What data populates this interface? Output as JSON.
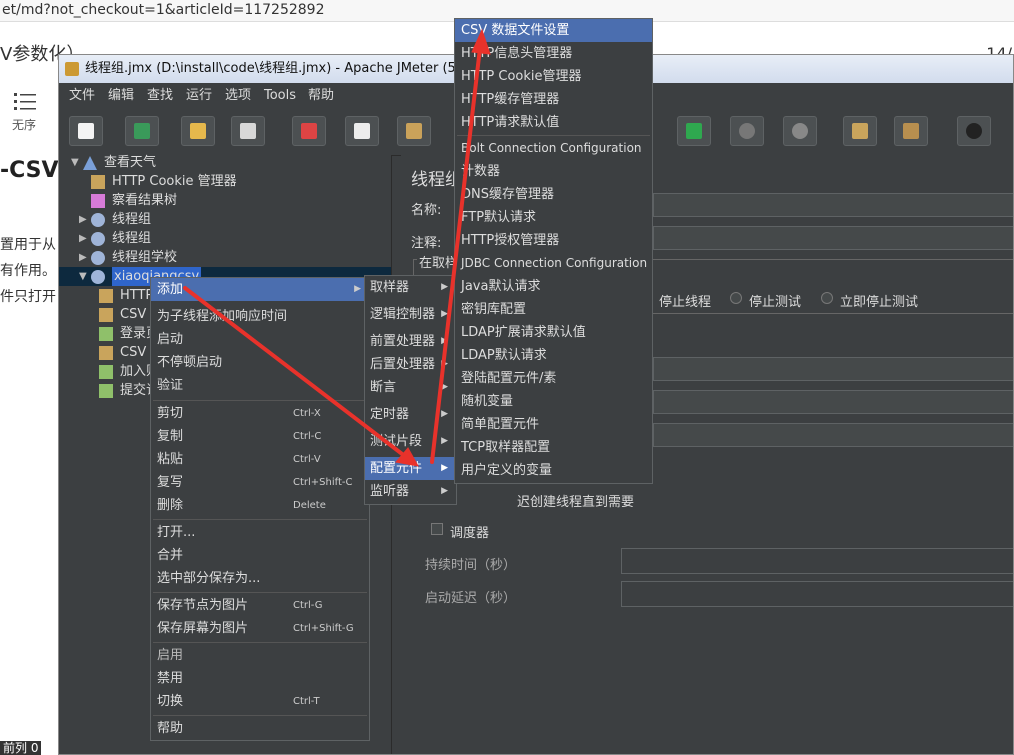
{
  "browser": {
    "url": "et/md?not_checkout=1&articleId=117252892",
    "tab_title": "V参数化）",
    "page_num": "14/",
    "list_label": "无序",
    "heading": "-CSV",
    "lines": [
      "置用于从",
      "有作用。",
      "件只打开"
    ],
    "status": "前列 0"
  },
  "window": {
    "title": "线程组.jmx (D:\\install\\code\\线程组.jmx) - Apache JMeter (5.2)",
    "menu": [
      "文件",
      "编辑",
      "查找",
      "运行",
      "选项",
      "Tools",
      "帮助"
    ]
  },
  "toolbar": {
    "icons": [
      "new-icon",
      "templates-icon",
      "open-icon",
      "save-icon",
      "cut-icon",
      "copy-icon",
      "paste-icon",
      "start-no-pause-icon",
      "stop-icon",
      "shutdown-icon",
      "clear-icon",
      "clear-all-icon",
      "search-icon"
    ]
  },
  "tree": {
    "items": [
      {
        "label": "查看天气"
      },
      {
        "label": "HTTP Cookie 管理器"
      },
      {
        "label": "察看结果树"
      },
      {
        "label": "线程组"
      },
      {
        "label": "线程组"
      },
      {
        "label": "线程组学校"
      },
      {
        "label": "xiaoqiangcsv"
      },
      {
        "label": "HTTP"
      },
      {
        "label": "CSV"
      },
      {
        "label": "登录页"
      },
      {
        "label": "CSV"
      },
      {
        "label": "加入则"
      },
      {
        "label": "提交订"
      }
    ]
  },
  "panel": {
    "title": "线程组",
    "name_label": "名称:",
    "comment_label": "注释:",
    "group_title": "在取样",
    "radio_stop_thread": "停止线程",
    "radio_stop_test": "停止测试",
    "radio_stop_now": "立即停止测试",
    "delay_create": "迟创建线程直到需要",
    "scheduler": "调度器",
    "duration_label": "持续时间（秒）",
    "startup_delay_label": "启动延迟（秒）"
  },
  "context_menu": {
    "items": [
      {
        "label": "添加",
        "shortcut": ""
      },
      {
        "label": "为子线程添加响应时间",
        "shortcut": ""
      },
      {
        "label": "启动",
        "shortcut": ""
      },
      {
        "label": "不停顿启动",
        "shortcut": ""
      },
      {
        "label": "验证",
        "shortcut": ""
      },
      {
        "label": "剪切",
        "shortcut": "Ctrl-X"
      },
      {
        "label": "复制",
        "shortcut": "Ctrl-C"
      },
      {
        "label": "粘贴",
        "shortcut": "Ctrl-V"
      },
      {
        "label": "复写",
        "shortcut": "Ctrl+Shift-C"
      },
      {
        "label": "删除",
        "shortcut": "Delete"
      },
      {
        "label": "打开...",
        "shortcut": ""
      },
      {
        "label": "合并",
        "shortcut": ""
      },
      {
        "label": "选中部分保存为...",
        "shortcut": ""
      },
      {
        "label": "保存节点为图片",
        "shortcut": "Ctrl-G"
      },
      {
        "label": "保存屏幕为图片",
        "shortcut": "Ctrl+Shift-G"
      },
      {
        "label": "启用",
        "shortcut": ""
      },
      {
        "label": "禁用",
        "shortcut": ""
      },
      {
        "label": "切换",
        "shortcut": "Ctrl-T"
      },
      {
        "label": "帮助",
        "shortcut": ""
      }
    ]
  },
  "add_submenu": {
    "items": [
      "取样器",
      "逻辑控制器",
      "前置处理器",
      "后置处理器",
      "断言",
      "定时器",
      "测试片段",
      "配置元件",
      "监听器"
    ]
  },
  "config_submenu": {
    "items": [
      "CSV 数据文件设置",
      "HTTP信息头管理器",
      "HTTP Cookie管理器",
      "HTTP缓存管理器",
      "HTTP请求默认值",
      "Bolt Connection Configuration",
      "计数器",
      "DNS缓存管理器",
      "FTP默认请求",
      "HTTP授权管理器",
      "JDBC Connection Configuration",
      "Java默认请求",
      "密钥库配置",
      "LDAP扩展请求默认值",
      "LDAP默认请求",
      "登陆配置元件/素",
      "随机变量",
      "简单配置元件",
      "TCP取样器配置",
      "用户定义的变量"
    ]
  },
  "colors": {
    "highlight": "#4b6eaf",
    "window_bg": "#3c3f41",
    "annotation_arrow": "#e8322b"
  }
}
